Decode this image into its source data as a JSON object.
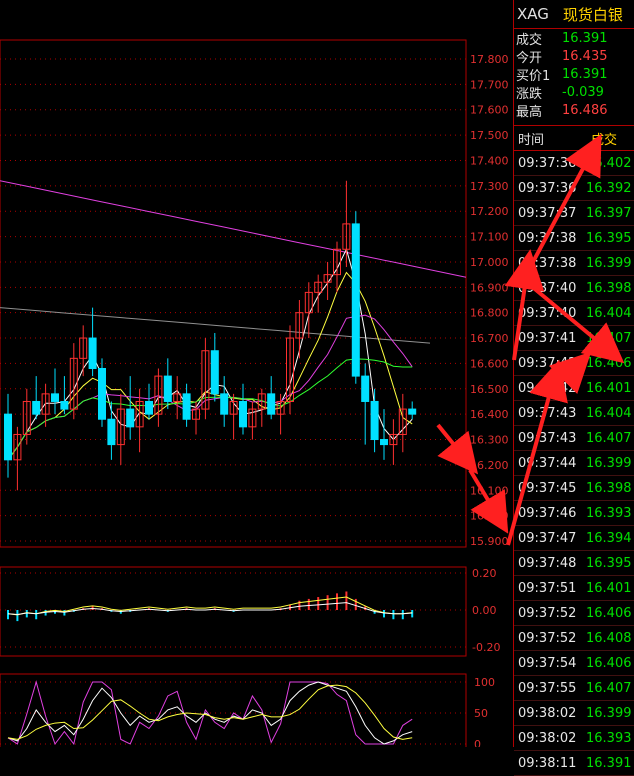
{
  "panel": {
    "symbol": "XAG",
    "name": "现货白银",
    "quote": [
      {
        "label": "成交",
        "value": "16.391",
        "color": "g"
      },
      {
        "label": "今开",
        "value": "16.435",
        "color": "r"
      },
      {
        "label": "买价1",
        "value": "16.391",
        "color": "g"
      },
      {
        "label": "涨跌",
        "value": "-0.039",
        "color": "g"
      },
      {
        "label": "最高",
        "value": "16.486",
        "color": "r"
      }
    ],
    "table_head": {
      "time": "时间",
      "price": "成交"
    },
    "ticks": [
      {
        "time": "09:37:36",
        "price": "16.402"
      },
      {
        "time": "09:37:36",
        "price": "16.392"
      },
      {
        "time": "09:37:37",
        "price": "16.397"
      },
      {
        "time": "09:37:38",
        "price": "16.395"
      },
      {
        "time": "09:37:38",
        "price": "16.399"
      },
      {
        "time": "09:37:40",
        "price": "16.398"
      },
      {
        "time": "09:37:40",
        "price": "16.404"
      },
      {
        "time": "09:37:41",
        "price": "16.407"
      },
      {
        "time": "09:37:42",
        "price": "16.406"
      },
      {
        "time": "09:37:42",
        "price": "16.401"
      },
      {
        "time": "09:37:43",
        "price": "16.404"
      },
      {
        "time": "09:37:43",
        "price": "16.407"
      },
      {
        "time": "09:37:44",
        "price": "16.399"
      },
      {
        "time": "09:37:45",
        "price": "16.398"
      },
      {
        "time": "09:37:46",
        "price": "16.393"
      },
      {
        "time": "09:37:47",
        "price": "16.394"
      },
      {
        "time": "09:37:48",
        "price": "16.395"
      },
      {
        "time": "09:37:51",
        "price": "16.401"
      },
      {
        "time": "09:37:52",
        "price": "16.406"
      },
      {
        "time": "09:37:52",
        "price": "16.408"
      },
      {
        "time": "09:37:54",
        "price": "16.406"
      },
      {
        "time": "09:37:55",
        "price": "16.407"
      },
      {
        "time": "09:38:02",
        "price": "16.399"
      },
      {
        "time": "09:38:02",
        "price": "16.393"
      },
      {
        "time": "09:38:11",
        "price": "16.391"
      }
    ]
  },
  "chart_data": [
    {
      "type": "candlestick",
      "ylim": [
        15.9,
        17.8
      ],
      "yticks": [
        "17.800",
        "17.700",
        "17.600",
        "17.500",
        "17.400",
        "17.300",
        "17.200",
        "17.100",
        "17.000",
        "16.900",
        "16.800",
        "16.700",
        "16.600",
        "16.500",
        "16.400",
        "16.300",
        "16.200",
        "16.100",
        "16.000",
        "15.900"
      ],
      "candles": [
        [
          16.4,
          16.48,
          16.15,
          16.22
        ],
        [
          16.22,
          16.35,
          16.1,
          16.32
        ],
        [
          16.32,
          16.5,
          16.28,
          16.45
        ],
        [
          16.45,
          16.55,
          16.38,
          16.4
        ],
        [
          16.4,
          16.52,
          16.35,
          16.48
        ],
        [
          16.48,
          16.58,
          16.4,
          16.45
        ],
        [
          16.45,
          16.55,
          16.4,
          16.42
        ],
        [
          16.42,
          16.68,
          16.38,
          16.62
        ],
        [
          16.62,
          16.75,
          16.55,
          16.7
        ],
        [
          16.7,
          16.82,
          16.55,
          16.58
        ],
        [
          16.58,
          16.62,
          16.35,
          16.38
        ],
        [
          16.38,
          16.45,
          16.22,
          16.28
        ],
        [
          16.28,
          16.48,
          16.2,
          16.42
        ],
        [
          16.42,
          16.55,
          16.3,
          16.35
        ],
        [
          16.35,
          16.5,
          16.25,
          16.45
        ],
        [
          16.45,
          16.52,
          16.38,
          16.4
        ],
        [
          16.4,
          16.58,
          16.35,
          16.55
        ],
        [
          16.55,
          16.62,
          16.42,
          16.45
        ],
        [
          16.45,
          16.55,
          16.38,
          16.48
        ],
        [
          16.48,
          16.52,
          16.35,
          16.38
        ],
        [
          16.38,
          16.45,
          16.32,
          16.42
        ],
        [
          16.42,
          16.7,
          16.38,
          16.65
        ],
        [
          16.65,
          16.72,
          16.45,
          16.48
        ],
        [
          16.48,
          16.55,
          16.35,
          16.4
        ],
        [
          16.4,
          16.48,
          16.3,
          16.45
        ],
        [
          16.45,
          16.52,
          16.32,
          16.35
        ],
        [
          16.35,
          16.45,
          16.3,
          16.42
        ],
        [
          16.42,
          16.5,
          16.35,
          16.48
        ],
        [
          16.48,
          16.55,
          16.38,
          16.4
        ],
        [
          16.4,
          16.48,
          16.32,
          16.45
        ],
        [
          16.45,
          16.75,
          16.4,
          16.7
        ],
        [
          16.7,
          16.85,
          16.62,
          16.8
        ],
        [
          16.8,
          16.92,
          16.7,
          16.88
        ],
        [
          16.88,
          16.95,
          16.8,
          16.92
        ],
        [
          16.92,
          17.0,
          16.85,
          16.95
        ],
        [
          16.95,
          17.08,
          16.88,
          17.05
        ],
        [
          17.05,
          17.32,
          16.98,
          17.15
        ],
        [
          17.15,
          17.2,
          16.52,
          16.55
        ],
        [
          16.55,
          16.6,
          16.28,
          16.45
        ],
        [
          16.45,
          16.5,
          16.25,
          16.3
        ],
        [
          16.3,
          16.42,
          16.22,
          16.28
        ],
        [
          16.28,
          16.38,
          16.2,
          16.32
        ],
        [
          16.32,
          16.48,
          16.25,
          16.42
        ],
        [
          16.42,
          16.45,
          16.38,
          16.4
        ]
      ],
      "ma": [
        {
          "color": "#e040e0",
          "values": [
            17.32,
            17.3,
            17.28,
            17.26,
            17.24,
            17.22,
            17.2,
            17.18,
            17.16,
            17.14,
            17.12,
            17.1,
            17.08,
            17.06,
            17.04,
            17.02,
            17.0,
            16.98,
            16.96,
            16.94
          ]
        },
        {
          "color": "#909090",
          "values": [
            16.82,
            16.81,
            16.8,
            16.79,
            16.78,
            16.77,
            16.76,
            16.75,
            16.74,
            16.73,
            16.72,
            16.71,
            16.7,
            16.69,
            16.68
          ]
        }
      ]
    },
    {
      "type": "bar",
      "ylim": [
        -0.2,
        0.2
      ],
      "yticks": [
        "0.20",
        "0.00",
        "-0.20"
      ]
    },
    {
      "type": "line",
      "ylim": [
        0,
        100
      ],
      "yticks": [
        "100",
        "50",
        "0"
      ]
    }
  ],
  "colors": {
    "up": "#ff3030",
    "down": "#00e0ff",
    "grid": "#b00000",
    "tick_text": "#e03030",
    "arrow": "#ff2020"
  }
}
